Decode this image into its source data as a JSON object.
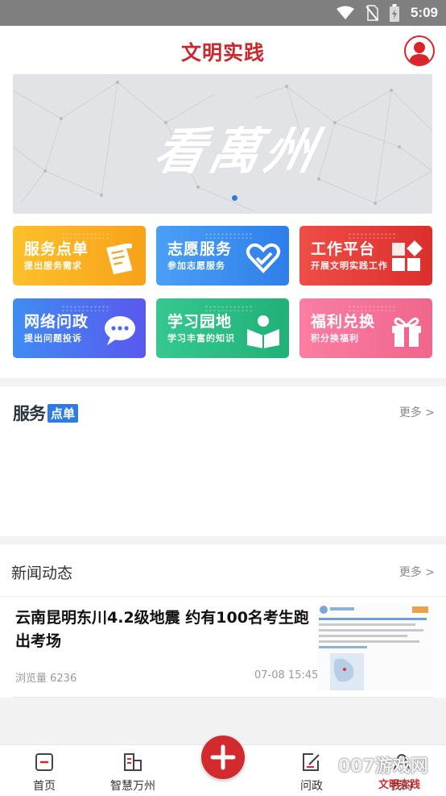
{
  "status_bar": {
    "time": "5:09",
    "icons": [
      "wifi-icon",
      "no-sim-icon",
      "battery-charging-icon"
    ]
  },
  "header": {
    "title": "文明实践",
    "avatar_icon": "user-avatar-icon"
  },
  "banner": {
    "calligraphy": "看萬州",
    "active_page": 1,
    "page_count": 1
  },
  "tiles": [
    {
      "title": "服务点单",
      "subtitle": "提出服务需求",
      "icon": "clipboard-icon",
      "color": "#fbb21c"
    },
    {
      "title": "志愿服务",
      "subtitle": "参加志愿服务",
      "icon": "heart-hands-icon",
      "color": "#3d8ff0"
    },
    {
      "title": "工作平台",
      "subtitle": "开展文明实践工作",
      "icon": "blocks-icon",
      "color": "#e8403c"
    },
    {
      "title": "网络问政",
      "subtitle": "提出问题投诉",
      "icon": "chat-bubble-icon",
      "color": "#4b6cf0"
    },
    {
      "title": "学习园地",
      "subtitle": "学习丰富的知识",
      "icon": "reading-icon",
      "color": "#2fbf84"
    },
    {
      "title": "福利兑换",
      "subtitle": "积分换福利",
      "icon": "gift-icon",
      "color": "#f56e94"
    }
  ],
  "service_section": {
    "title_main": "服务",
    "title_badge": "点单",
    "more": "更多 >"
  },
  "news_section": {
    "heading": "新闻动态",
    "more": "更多 >",
    "items": [
      {
        "title": "云南昆明东川4.2级地震 约有100名考生跑出考场",
        "views": "浏览量 6236",
        "time": "07-08 15:45"
      }
    ]
  },
  "bottom_nav": {
    "items": [
      {
        "label": "首页",
        "icon": "home-icon"
      },
      {
        "label": "智慧万州",
        "icon": "building-icon"
      },
      {
        "label": "问政",
        "icon": "edit-icon"
      },
      {
        "label": "我的",
        "icon": "user-icon"
      }
    ],
    "fab_icon": "plus-icon"
  },
  "watermark": {
    "main": "007游戏网",
    "sub": "文明实践"
  }
}
